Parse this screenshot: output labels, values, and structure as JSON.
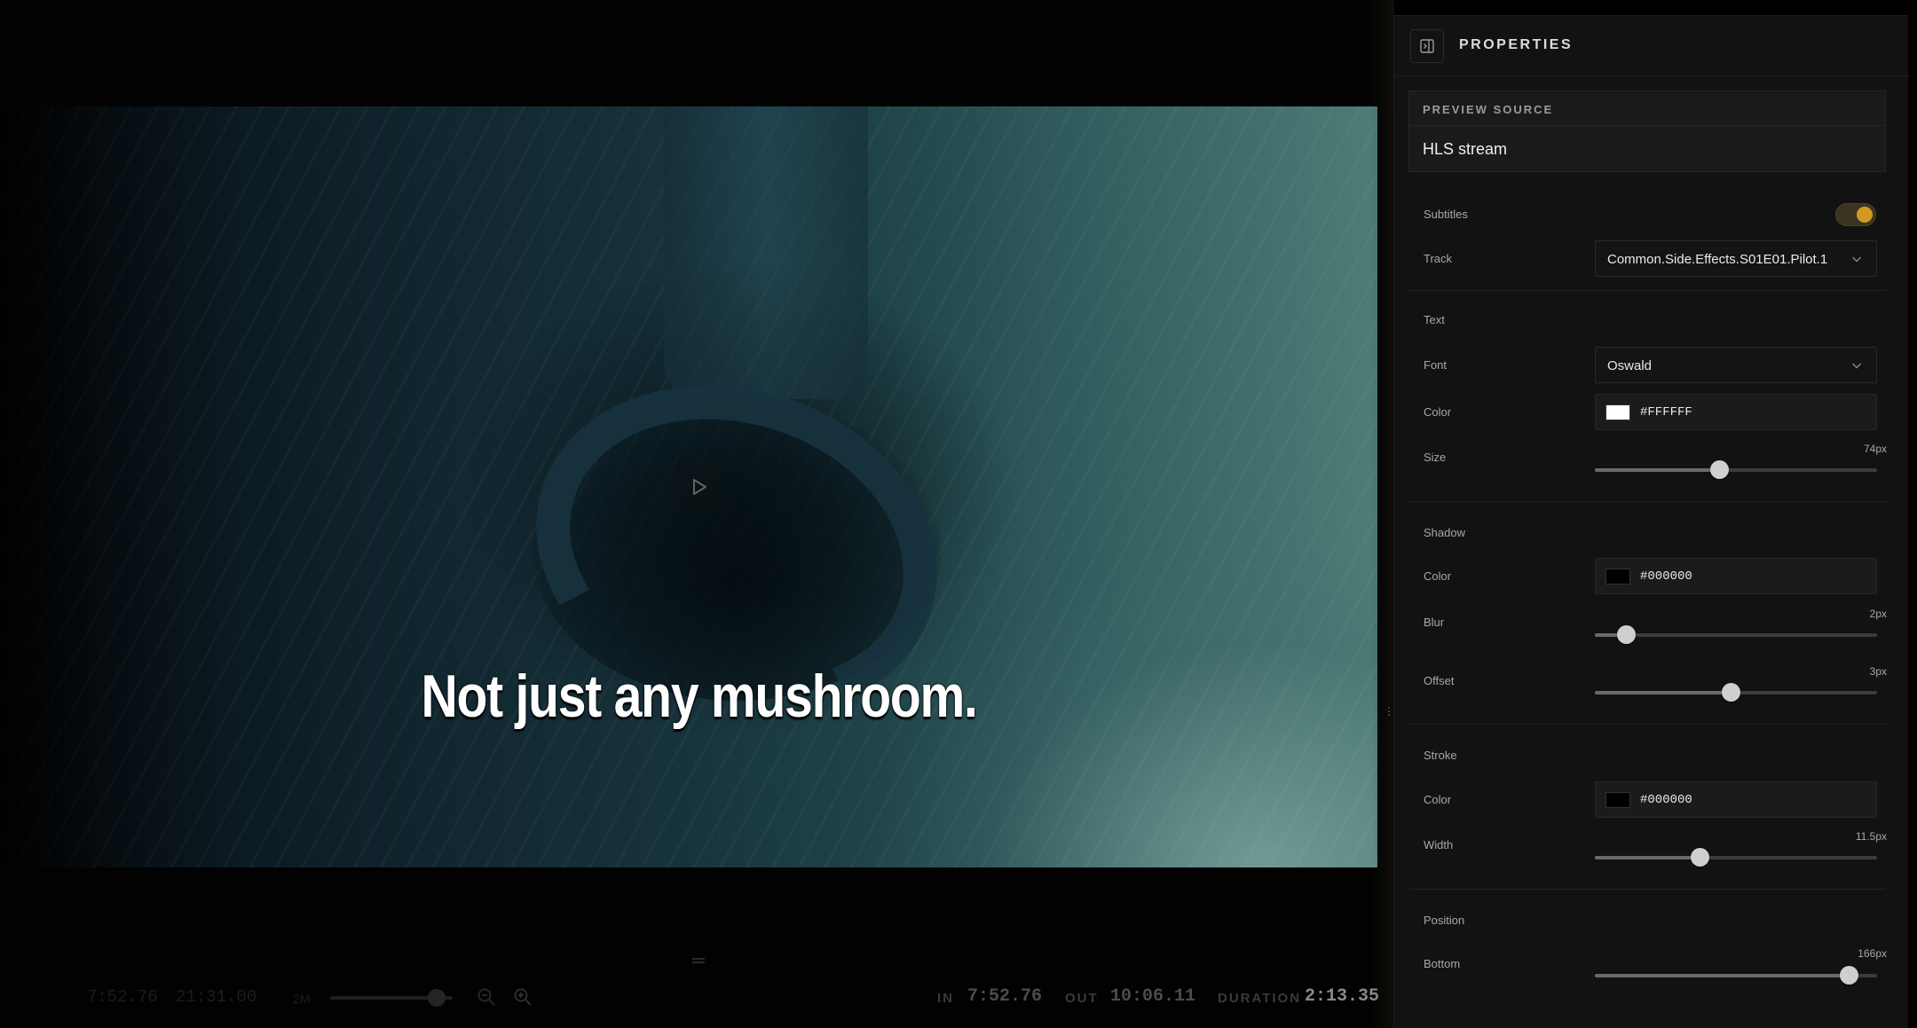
{
  "video": {
    "subtitle_text": "Not just any mushroom."
  },
  "toolbar": {
    "current_time": "7:52.76",
    "total_time": "21:31.00",
    "zoom_label": "2M",
    "zoom_level": 0.8,
    "in_label": "IN",
    "in_value": "7:52.76",
    "out_label": "OUT",
    "out_value": "10:06.11",
    "duration_label": "DURATION",
    "duration_value": "2:13.35",
    "icons": [
      "zoom-out-icon",
      "zoom-in-icon",
      "play-icon"
    ]
  },
  "panel": {
    "title": "PROPERTIES",
    "preview_source": {
      "label": "PREVIEW SOURCE",
      "value": "HLS stream"
    },
    "subtitles": {
      "label": "Subtitles",
      "enabled": true
    },
    "track": {
      "label": "Track",
      "value": "Common.Side.Effects.S01E01.Pilot.1"
    },
    "text": {
      "section": "Text",
      "font_label": "Font",
      "font_value": "Oswald",
      "color_label": "Color",
      "color_value": "#FFFFFF",
      "size_label": "Size",
      "size_value": "74px",
      "size_fraction": 0.44
    },
    "shadow": {
      "section": "Shadow",
      "color_label": "Color",
      "color_value": "#000000",
      "blur_label": "Blur",
      "blur_value": "2px",
      "blur_fraction": 0.11,
      "offset_label": "Offset",
      "offset_value": "3px",
      "offset_fraction": 0.48
    },
    "stroke": {
      "section": "Stroke",
      "color_label": "Color",
      "color_value": "#000000",
      "width_label": "Width",
      "width_value": "11.5px",
      "width_fraction": 0.37
    },
    "position": {
      "section": "Position",
      "bottom_label": "Bottom",
      "bottom_value": "166px",
      "bottom_fraction": 0.9
    }
  },
  "colors": {
    "accent": "#d39a22",
    "panel_bg": "#121212"
  }
}
